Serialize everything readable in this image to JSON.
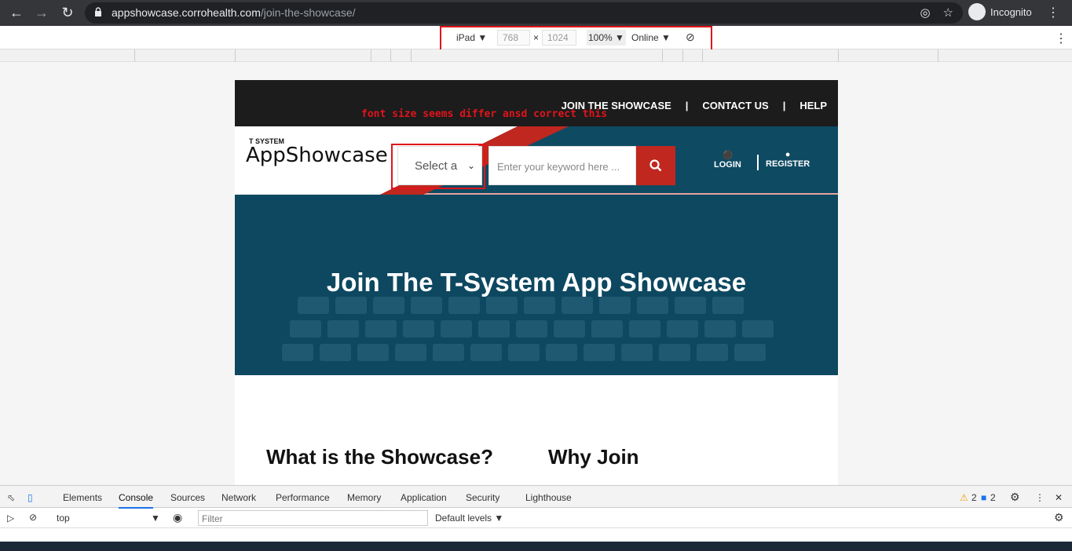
{
  "browser": {
    "url_domain": "appshowcase.corrohealth.com",
    "url_path": "/join-the-showcase/",
    "incognito_label": "Incognito"
  },
  "device_toolbar": {
    "device": "iPad",
    "width": "768",
    "height": "1024",
    "zoom": "100%",
    "network": "Online"
  },
  "site": {
    "top_nav": [
      "JOIN THE SHOWCASE",
      "CONTACT US",
      "HELP"
    ],
    "annotation": "font size seems differ ansd correct this",
    "logo_small": "T SYSTEM",
    "logo_main": "AppShowcase",
    "select_placeholder": "Select a",
    "search_placeholder": "Enter your keyword here ...",
    "login": "LOGIN",
    "register": "REGISTER",
    "hero_title": "Join The T-System App Showcase",
    "section_left": "What is the Showcase?",
    "section_right": "Why Join"
  },
  "devtools": {
    "tabs": [
      "Elements",
      "Console",
      "Sources",
      "Network",
      "Performance",
      "Memory",
      "Application",
      "Security",
      "Lighthouse"
    ],
    "active_tab": "Console",
    "warnings": "2",
    "messages": "2",
    "context": "top",
    "filter_placeholder": "Filter",
    "levels": "Default levels ▼"
  },
  "colors": {
    "brand_red": "#c0271e",
    "header_blue": "#0f4a63",
    "annotation_red": "#e0141b"
  }
}
